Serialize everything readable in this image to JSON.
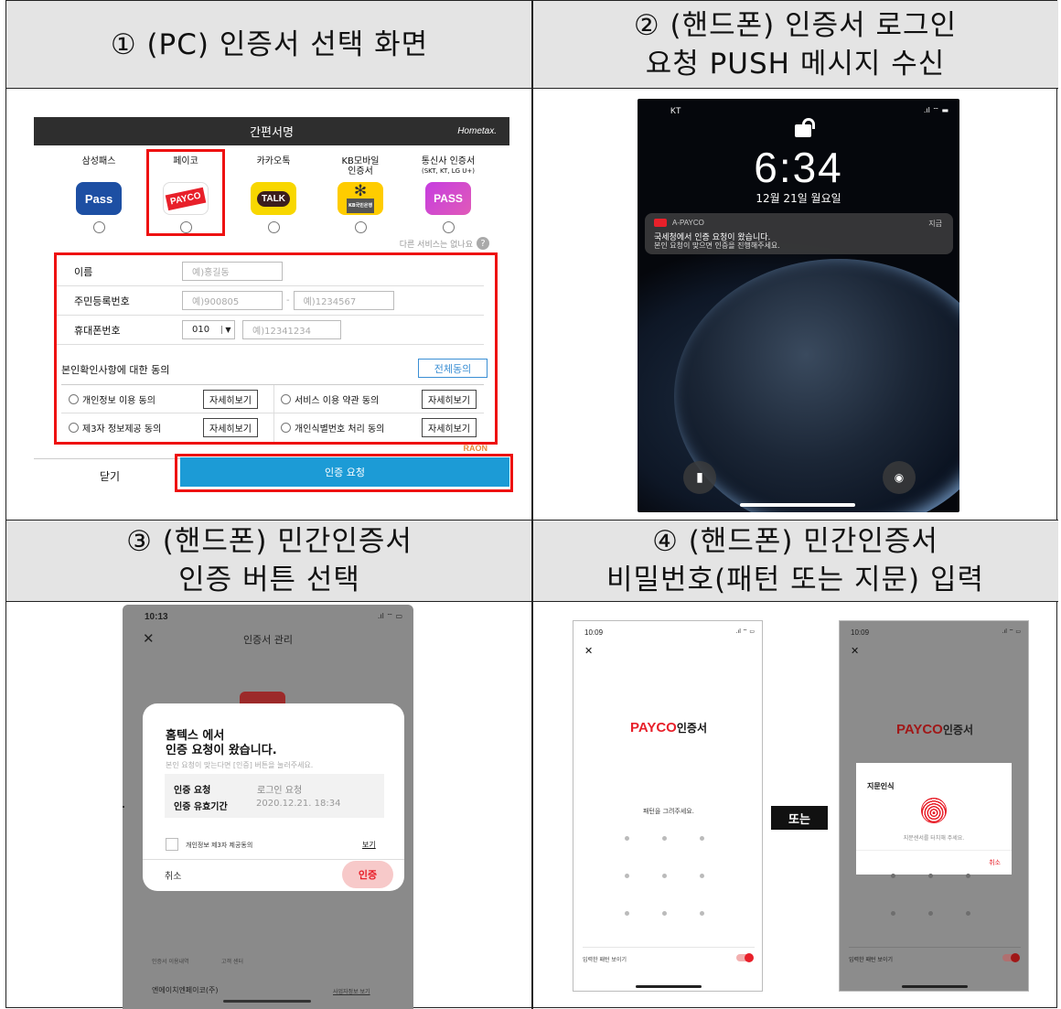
{
  "cells": [
    {
      "title_lines": [
        "① (PC) 인증서 선택 화면"
      ]
    },
    {
      "title_lines": [
        "② (핸드폰) 인증서 로그인",
        "요청 PUSH 메시지 수신"
      ]
    },
    {
      "title_lines": [
        "③ (핸드폰) 민간인증서",
        "인증 버튼 선택"
      ]
    },
    {
      "title_lines": [
        "④ (핸드폰) 민간인증서",
        "비밀번호(패턴 또는 지문) 입력"
      ]
    }
  ],
  "panel1": {
    "header": "간편서명",
    "hometax": "Hometax.",
    "services": [
      {
        "label": "삼성패스",
        "icon_text": "SAMSUNG Pass",
        "color": "#1d4fa3"
      },
      {
        "label": "페이코",
        "icon_text": "PAYCO",
        "color": "#e8202a"
      },
      {
        "label": "카카오톡",
        "icon_text": "TALK",
        "color": "#f8d700"
      },
      {
        "label": "KB모바일\n인증서",
        "icon_text": "KB국민은행",
        "color": "#ffcc00"
      },
      {
        "label": "통신사 인증서",
        "sublabel": "(SKT, KT, LG U+)",
        "icon_text": "PASS",
        "color": "#d94adf"
      }
    ],
    "other_service": "다른 서비스는 없나요",
    "name_label": "이름",
    "name_placeholder": "예)홍길동",
    "rrn_label": "주민등록번호",
    "rrn_ph1": "예)900805",
    "rrn_ph2": "예)1234567",
    "phone_label": "휴대폰번호",
    "phone_prefix": "010",
    "phone_ph": "예)12341234",
    "consent_title": "본인확인사항에 대한 동의",
    "consent_all": "전체동의",
    "consents": [
      "개인정보 이용 동의",
      "서비스 이용 약관 동의",
      "제3자 정보제공 동의",
      "개인식별번호 처리 동의"
    ],
    "detail_btn": "자세히보기",
    "raon": "RAON",
    "close": "닫기",
    "submit": "인증 요청"
  },
  "panel2": {
    "carrier": "KT",
    "time": "6:34",
    "date": "12월 21일 월요일",
    "app": "A-PAYCO",
    "when": "지금",
    "msg1": "국세청에서 인증 요청이 왔습니다.",
    "msg2": "본인 요청이 맞으면 인증을 진행해주세요."
  },
  "panel3": {
    "time": "10:13",
    "title": "인증서 관리",
    "head1": "홈텍스 에서",
    "head2": "인증 요청이 왔습니다.",
    "sub": "본인 요청이 맞는다면 [인증] 버튼을 눌러주세요.",
    "req_label": "인증 요청",
    "req_value": "로그인 요청",
    "exp_label": "인증 유효기간",
    "exp_value": "2020.12.21. 18:34",
    "agree": "개인정보 제3자 제공동의",
    "view": "보기",
    "cancel": "취소",
    "confirm": "인증",
    "bottom1": "인증서 이용내역",
    "bottom2": "고객 센터",
    "company": "엔에이치엔페이코(주)",
    "biz": "사업자정보 보기"
  },
  "panel4": {
    "time": "10:09",
    "brand": "PAYCO",
    "brand_suffix": "인증서",
    "pattern_hint": "패턴을 그려주세요.",
    "show_pattern": "입력한 패턴 보이기",
    "or": "또는",
    "fp_title": "지문인식",
    "fp_hint": "지문센서를 터치해 주세요.",
    "fp_cancel": "취소"
  }
}
